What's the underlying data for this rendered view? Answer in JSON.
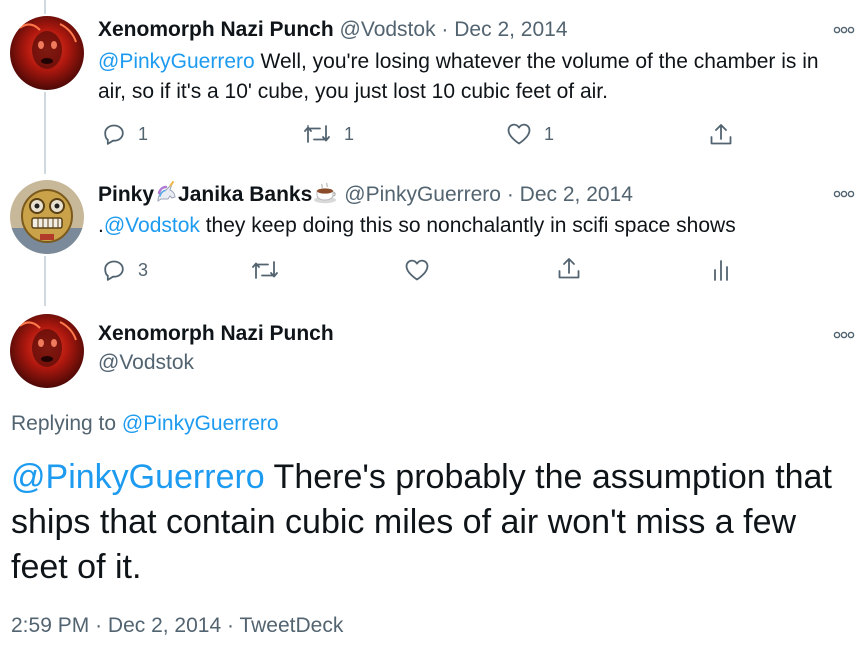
{
  "tweet1": {
    "name": "Xenomorph Nazi Punch",
    "handle": "@Vodstok",
    "separator": "·",
    "date": "Dec 2, 2014",
    "mention": "@PinkyGuerrero",
    "text": " Well, you're losing whatever the volume of the chamber is in air, so if it's a 10' cube, you just lost 10 cubic feet of air.",
    "reply_count": "1",
    "retweet_count": "1",
    "like_count": "1"
  },
  "tweet2": {
    "name_part1": "Pinky",
    "name_emoji1": "unicorn-emoji",
    "name_part2": "Janika Banks",
    "name_emoji2": "coffee-emoji",
    "handle": "@PinkyGuerrero",
    "separator": "·",
    "date": "Dec 2, 2014",
    "text_prefix": ".",
    "mention": "@Vodstok",
    "text": " they keep doing this so nonchalantly in scifi space shows",
    "reply_count": "3"
  },
  "focused": {
    "name": "Xenomorph Nazi Punch",
    "handle": "@Vodstok",
    "replying_prefix": "Replying to ",
    "replying_to": "@PinkyGuerrero",
    "mention": "@PinkyGuerrero",
    "text": " There's probably the assumption that ships that contain cubic miles of air won't miss a few feet of it.",
    "time": "2:59 PM",
    "date": "Dec 2, 2014",
    "separator": "·",
    "source": "TweetDeck"
  },
  "icons": {
    "reply": "reply-icon",
    "retweet": "retweet-icon",
    "like": "heart-icon",
    "share": "share-icon",
    "analytics": "analytics-icon",
    "more": "more-icon"
  },
  "colors": {
    "link": "#1d9bf0",
    "muted": "#536471",
    "text": "#0f1419",
    "thread_line": "#cfd9de"
  }
}
